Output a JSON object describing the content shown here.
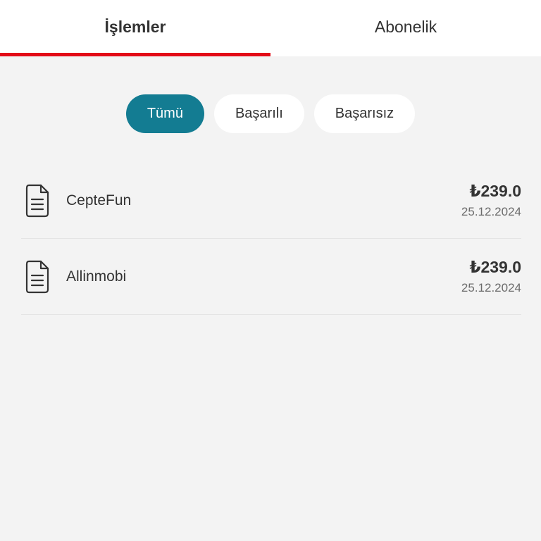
{
  "tabs": [
    {
      "label": "İşlemler",
      "active": true
    },
    {
      "label": "Abonelik",
      "active": false
    }
  ],
  "filters": [
    {
      "label": "Tümü",
      "active": true
    },
    {
      "label": "Başarılı",
      "active": false
    },
    {
      "label": "Başarısız",
      "active": false
    }
  ],
  "transactions": [
    {
      "name": "CepteFun",
      "amount": "₺239.0",
      "date": "25.12.2024",
      "icon": "document-icon"
    },
    {
      "name": "Allinmobi",
      "amount": "₺239.0",
      "date": "25.12.2024",
      "icon": "document-icon"
    }
  ],
  "colors": {
    "accent_red": "#e30a17",
    "active_chip": "#137c92",
    "background": "#f3f3f3"
  }
}
